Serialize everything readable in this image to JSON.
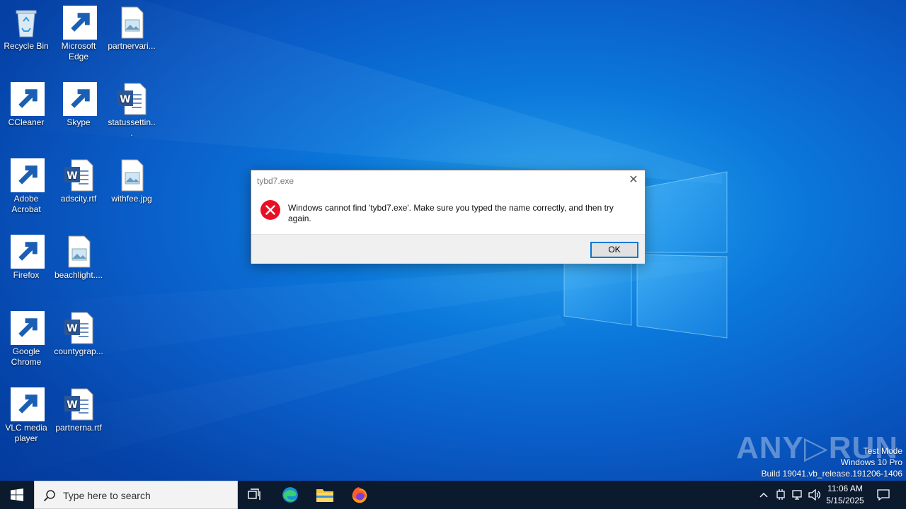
{
  "desktop": {
    "icons": [
      {
        "label": "Recycle Bin"
      },
      {
        "label": "Microsoft Edge"
      },
      {
        "label": "partnervari..."
      },
      {
        "label": "CCleaner"
      },
      {
        "label": "Skype"
      },
      {
        "label": "statussettin..."
      },
      {
        "label": "Adobe Acrobat"
      },
      {
        "label": "adscity.rtf"
      },
      {
        "label": "withfee.jpg"
      },
      {
        "label": "Firefox"
      },
      {
        "label": "beachlight...."
      },
      {
        "label": "Google Chrome"
      },
      {
        "label": "countygrap..."
      },
      {
        "label": "VLC media player"
      },
      {
        "label": "partnerna.rtf"
      }
    ]
  },
  "dialog": {
    "title": "tybd7.exe",
    "close_glyph": "✕",
    "message": "Windows cannot find 'tybd7.exe'. Make sure you typed the name correctly, and then try again.",
    "ok_label": "OK"
  },
  "watermark": {
    "brand": "ANY▷RUN",
    "mode": "Test Mode",
    "edition": "Windows 10 Pro",
    "build": "Build 19041.vb_release.191206-1406"
  },
  "taskbar": {
    "search_placeholder": "Type here to search",
    "time": "11:06 AM",
    "date": "5/15/2025"
  },
  "colors": {
    "accent": "#0078d7",
    "error_red": "#e81123",
    "taskbar_bg": "#0c1a2e"
  }
}
